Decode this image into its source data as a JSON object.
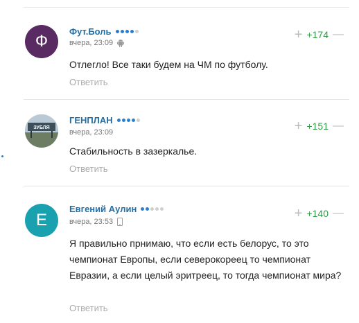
{
  "comments": [
    {
      "avatar_letter": "Ф",
      "avatar_color": "#5a2a63",
      "author": "Фут.Боль",
      "rating": [
        1,
        1,
        1,
        1,
        0
      ],
      "time": "вчера, 23:09",
      "device_icon": "android-icon",
      "text": "Отлегло! Все таки будем на ЧМ по футболу.",
      "reply_label": "Ответить",
      "score": "+174",
      "plus_label": "+",
      "minus_label": "—"
    },
    {
      "avatar_letter": "",
      "avatar_color": "#8aa3b8",
      "avatar_caption": "ЗУБЛЯ",
      "author": "ГЕНПЛАН",
      "rating": [
        1,
        1,
        1,
        1,
        0
      ],
      "time": "вчера, 23:09",
      "device_icon": "",
      "text": "Стабильность в зазеркалье.",
      "reply_label": "Ответить",
      "score": "+151",
      "plus_label": "+",
      "minus_label": "—"
    },
    {
      "avatar_letter": "Е",
      "avatar_color": "#1aa1b0",
      "author": "Евгений Аулин",
      "rating": [
        1,
        1,
        0,
        0,
        0
      ],
      "time": "вчера, 23:53",
      "device_icon": "mobile-phone-icon",
      "text": "Я правильно прнимаю, что если есть белорус, то это чемпионат Европы, если северокореец то чемпионат Евразии, а если целый эритреец, то тогда чемпионат мира?",
      "reply_label": "Ответить",
      "score": "+140",
      "plus_label": "+",
      "minus_label": "—"
    }
  ],
  "colors": {
    "accent": "#1f6fa8",
    "positive": "#2e9b43",
    "rating_on": "#2b7fd1",
    "rating_off": "#cfcfcf"
  }
}
